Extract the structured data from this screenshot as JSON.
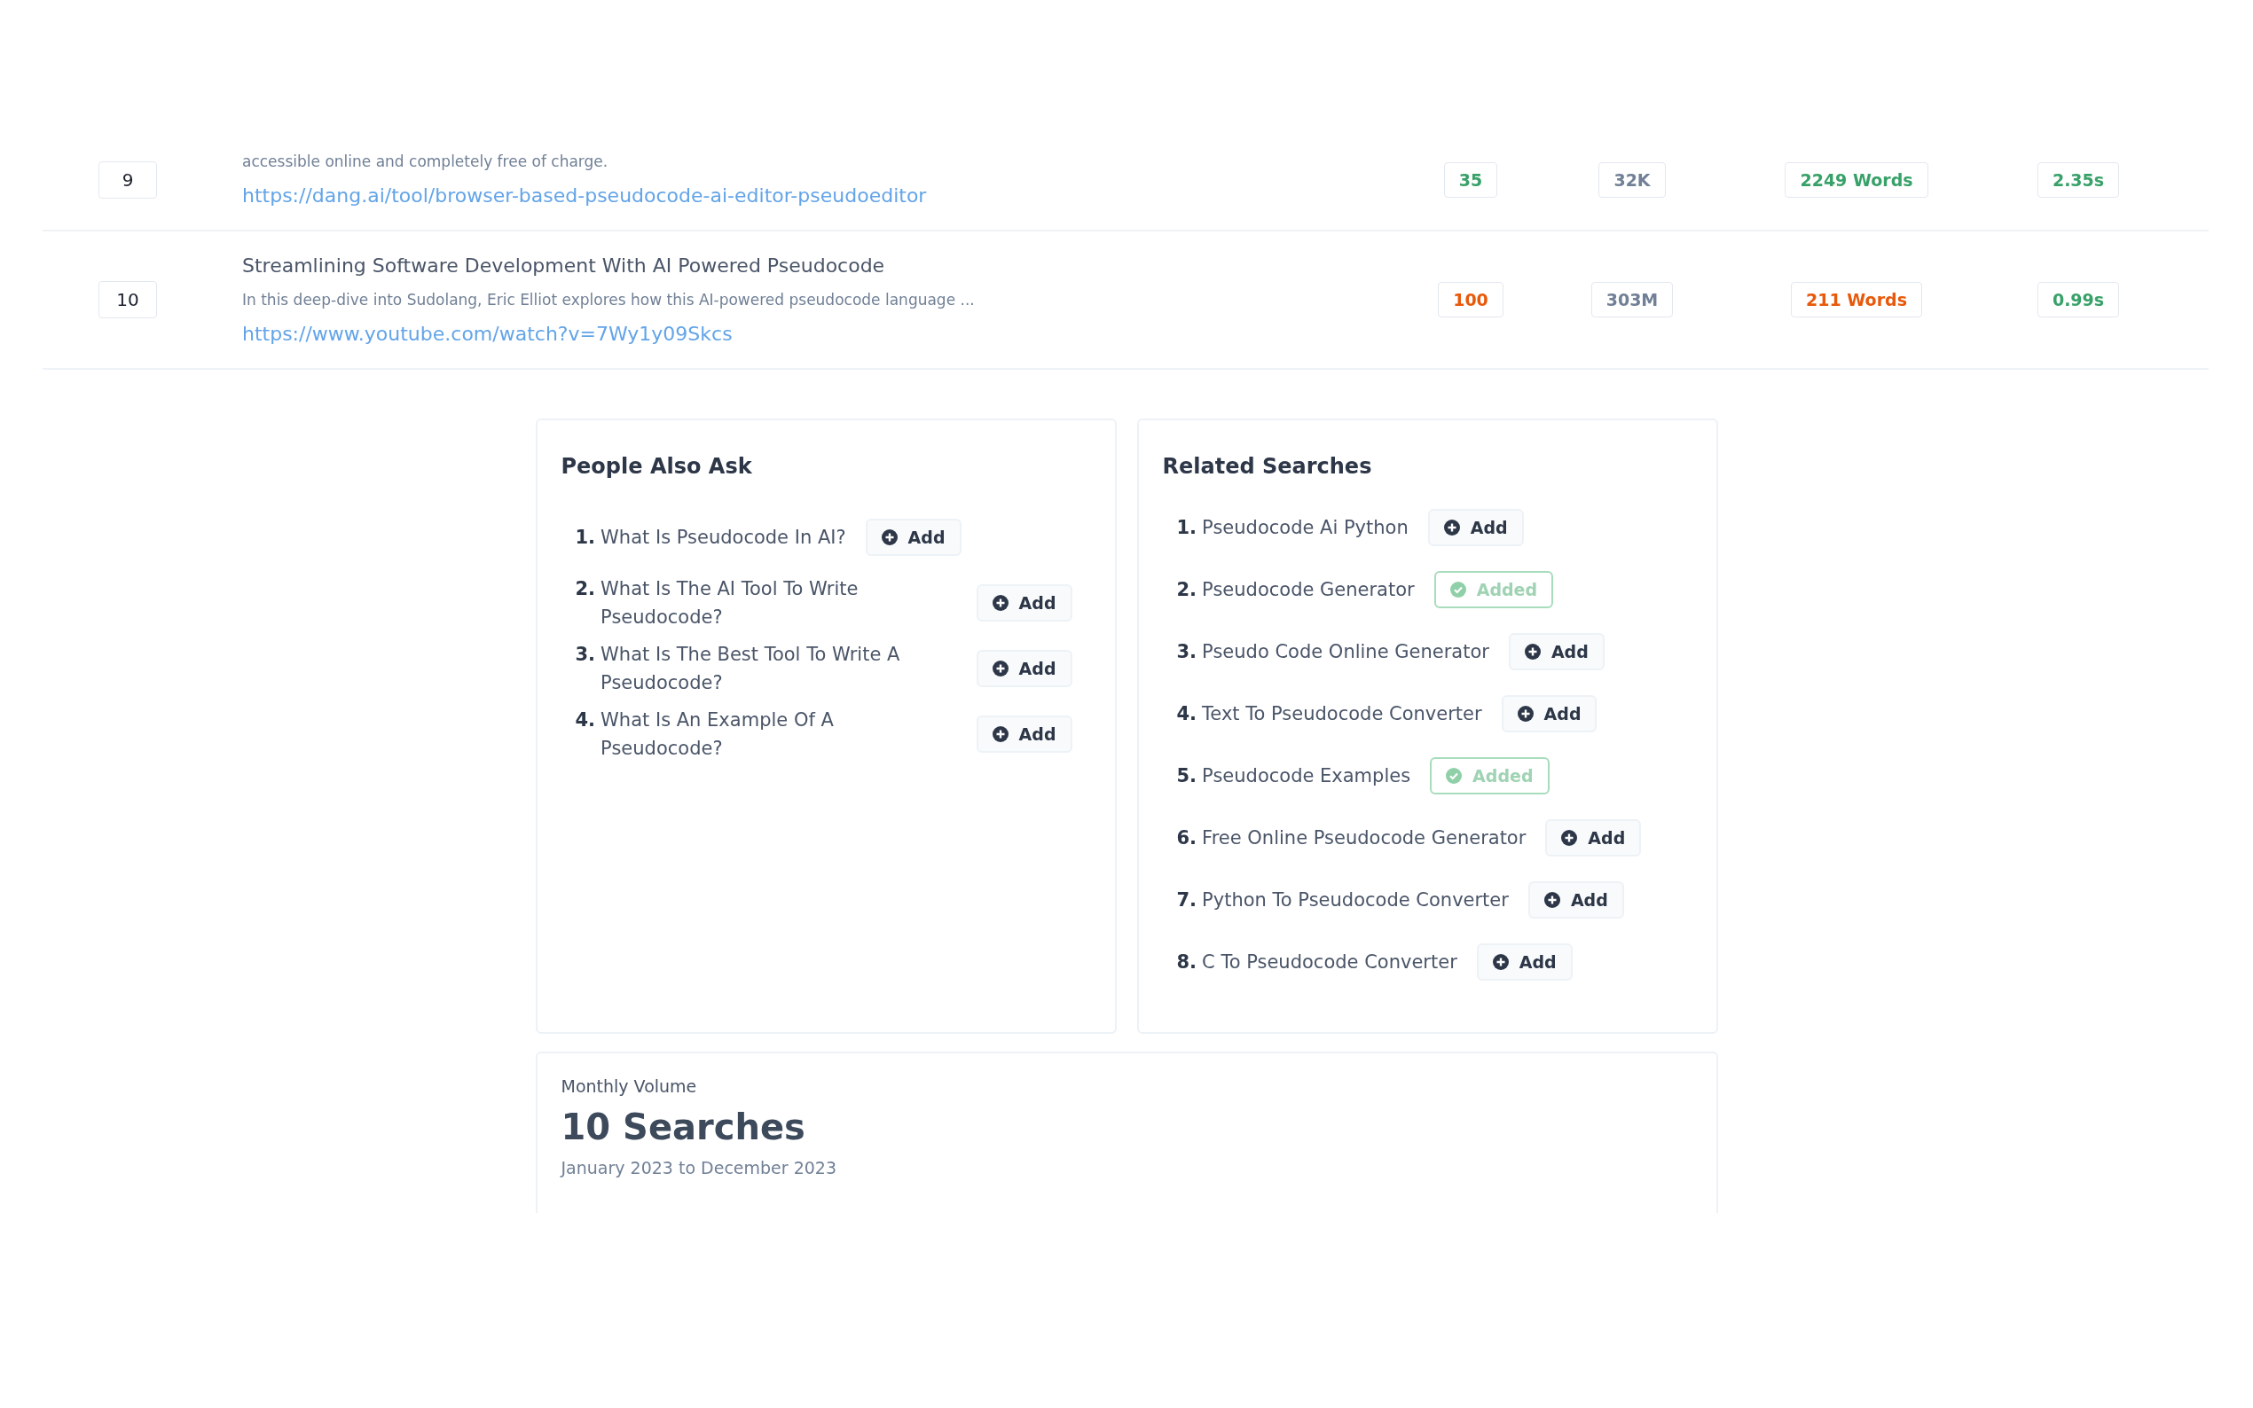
{
  "results": [
    {
      "rank": "9",
      "description": "accessible online and completely free of charge.",
      "url": "https://dang.ai/tool/browser-based-pseudocode-ai-editor-pseudoeditor",
      "score": {
        "text": "35",
        "color": "#38a169"
      },
      "volume": "32K",
      "words": {
        "text": "2249 Words",
        "color": "#38a169"
      },
      "time": {
        "text": "2.35s",
        "color": "#38a169"
      }
    },
    {
      "rank": "10",
      "title": "Streamlining Software Development With AI Powered Pseudocode",
      "description": "In this deep-dive into Sudolang, Eric Elliot explores how this AI-powered pseudocode language ...",
      "url": "https://www.youtube.com/watch?v=7Wy1y09Skcs",
      "score": {
        "text": "100",
        "color": "#e8590c"
      },
      "volume": "303M",
      "words": {
        "text": "211 Words",
        "color": "#e8590c"
      },
      "time": {
        "text": "0.99s",
        "color": "#38a169"
      }
    }
  ],
  "people_also_ask": {
    "title": "People Also Ask",
    "items": [
      {
        "number": "1.",
        "text": "What Is Pseudocode In AI?",
        "added": false,
        "button": "Add"
      },
      {
        "number": "2.",
        "text": "What Is The AI Tool To Write Pseudocode?",
        "added": false,
        "button": "Add"
      },
      {
        "number": "3.",
        "text": "What Is The Best Tool To Write A Pseudocode?",
        "added": false,
        "button": "Add"
      },
      {
        "number": "4.",
        "text": "What Is An Example Of A Pseudocode?",
        "added": false,
        "button": "Add"
      }
    ]
  },
  "related_searches": {
    "title": "Related Searches",
    "items": [
      {
        "number": "1.",
        "text": "Pseudocode Ai Python",
        "added": false,
        "button": "Add"
      },
      {
        "number": "2.",
        "text": "Pseudocode Generator",
        "added": true,
        "button": "Added"
      },
      {
        "number": "3.",
        "text": "Pseudo Code Online Generator",
        "added": false,
        "button": "Add"
      },
      {
        "number": "4.",
        "text": "Text To Pseudocode Converter",
        "added": false,
        "button": "Add"
      },
      {
        "number": "5.",
        "text": "Pseudocode Examples",
        "added": true,
        "button": "Added"
      },
      {
        "number": "6.",
        "text": "Free Online Pseudocode Generator",
        "added": false,
        "button": "Add"
      },
      {
        "number": "7.",
        "text": "Python To Pseudocode Converter",
        "added": false,
        "button": "Add"
      },
      {
        "number": "8.",
        "text": "C To Pseudocode Converter",
        "added": false,
        "button": "Add"
      }
    ]
  },
  "monthly_volume": {
    "label": "Monthly Volume",
    "value": "10 Searches",
    "range": "January 2023 to December 2023"
  }
}
